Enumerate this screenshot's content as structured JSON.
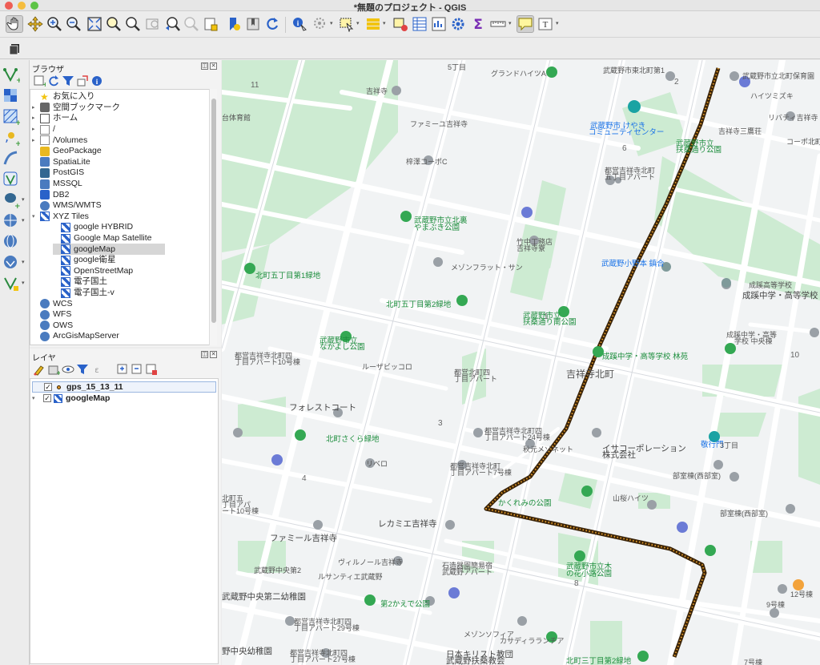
{
  "window": {
    "title": "*無題のプロジェクト - QGIS"
  },
  "toolbar": {
    "icons": [
      "pan-hand-icon",
      "pan-to-selection-icon",
      "zoom-in-icon",
      "zoom-out-icon",
      "zoom-full-icon",
      "zoom-to-selection-icon",
      "zoom-to-layer-icon",
      "zoom-native-icon",
      "zoom-last-icon",
      "zoom-next-icon",
      "new-bookmark-icon",
      "show-bookmarks-icon",
      "refresh-icon",
      "identify-icon",
      "actions-icon",
      "select-features-icon",
      "attribute-table-icon",
      "deselect-icon",
      "field-calculator-icon",
      "processing-gear-icon",
      "statistics-sigma-icon",
      "measure-icon",
      "map-tips-icon",
      "text-annotation-icon"
    ]
  },
  "browser": {
    "title": "ブラウザ",
    "items": [
      {
        "label": "お気に入り",
        "icon": "star-icon",
        "expand": ""
      },
      {
        "label": "空間ブックマーク",
        "icon": "bookmark-icon",
        "expand": "▸"
      },
      {
        "label": "ホーム",
        "icon": "home-icon",
        "expand": "▸"
      },
      {
        "label": "/",
        "icon": "folder-icon",
        "expand": "▸"
      },
      {
        "label": "/Volumes",
        "icon": "folder-icon",
        "expand": "▸"
      },
      {
        "label": "GeoPackage",
        "icon": "geopackage-icon",
        "expand": ""
      },
      {
        "label": "SpatiaLite",
        "icon": "spatialite-icon",
        "expand": ""
      },
      {
        "label": "PostGIS",
        "icon": "postgis-icon",
        "expand": ""
      },
      {
        "label": "MSSQL",
        "icon": "mssql-icon",
        "expand": ""
      },
      {
        "label": "DB2",
        "icon": "db2-icon",
        "expand": ""
      },
      {
        "label": "WMS/WMTS",
        "icon": "wms-icon",
        "expand": ""
      },
      {
        "label": "XYZ Tiles",
        "icon": "xyz-icon",
        "expand": "▾"
      },
      {
        "label": "google HYBRID",
        "icon": "tile-icon",
        "expand": "",
        "indent": 1
      },
      {
        "label": "Google Map Satellite",
        "icon": "tile-icon",
        "expand": "",
        "indent": 1
      },
      {
        "label": "googleMap",
        "icon": "tile-icon",
        "expand": "",
        "indent": 1,
        "selected": true
      },
      {
        "label": "google衛星",
        "icon": "tile-icon",
        "expand": "",
        "indent": 1
      },
      {
        "label": "OpenStreetMap",
        "icon": "tile-icon",
        "expand": "",
        "indent": 1
      },
      {
        "label": "電子国土",
        "icon": "tile-icon",
        "expand": "",
        "indent": 1
      },
      {
        "label": "電子国土-v",
        "icon": "tile-icon",
        "expand": "",
        "indent": 1
      },
      {
        "label": "WCS",
        "icon": "globe-icon",
        "expand": ""
      },
      {
        "label": "WFS",
        "icon": "globe-icon",
        "expand": ""
      },
      {
        "label": "OWS",
        "icon": "globe-icon",
        "expand": ""
      },
      {
        "label": "ArcGisMapServer",
        "icon": "globe-icon",
        "expand": ""
      }
    ]
  },
  "layers": {
    "title": "レイヤ",
    "items": [
      {
        "label": "gps_15_13_11",
        "checked": "✓",
        "icon": "point-layer-icon",
        "selected": true
      },
      {
        "label": "googleMap",
        "checked": "✓",
        "icon": "tile-layer-icon",
        "selected": false
      }
    ]
  },
  "map": {
    "labels": [
      {
        "text": "11",
        "cls": "num"
      },
      {
        "text": "台体育館",
        "cls": ""
      },
      {
        "text": "吉祥寺",
        "cls": ""
      },
      {
        "text": "グランドハイツA",
        "cls": ""
      },
      {
        "text": "5丁目",
        "cls": ""
      },
      {
        "text": "武蔵野市東北町第1",
        "cls": ""
      },
      {
        "text": "2",
        "cls": "num"
      },
      {
        "text": "武蔵野市立北町保育園",
        "cls": ""
      },
      {
        "text": "ハイツミズキ",
        "cls": ""
      },
      {
        "text": "リバティ吉祥寺",
        "cls": ""
      },
      {
        "text": "ファミーユ吉祥寺",
        "cls": ""
      },
      {
        "text": "武蔵野市 けやき",
        "cls": "teal"
      },
      {
        "text": "コミュニティセンター",
        "cls": "teal"
      },
      {
        "text": "吉祥寺三鷹荘",
        "cls": ""
      },
      {
        "text": "コーポ北町",
        "cls": ""
      },
      {
        "text": "武蔵野市立",
        "cls": "green"
      },
      {
        "text": "扶桑通り公園",
        "cls": "green"
      },
      {
        "text": "6",
        "cls": "num"
      },
      {
        "text": "梓澤コーポC",
        "cls": ""
      },
      {
        "text": "都営吉祥寺北町",
        "cls": ""
      },
      {
        "text": "五丁目アパート",
        "cls": ""
      },
      {
        "text": "武蔵野市立北裏",
        "cls": "green"
      },
      {
        "text": "やまぶき公園",
        "cls": "green"
      },
      {
        "text": "竹中工務店",
        "cls": ""
      },
      {
        "text": "吉祥寺寮",
        "cls": ""
      },
      {
        "text": "メゾンフラット・サン",
        "cls": ""
      },
      {
        "text": "武蔵野小野本 鎮合",
        "cls": "teal"
      },
      {
        "text": "北町五丁目第1緑地",
        "cls": "green"
      },
      {
        "text": "北町五丁目第2緑地",
        "cls": "green"
      },
      {
        "text": "1",
        "cls": "num"
      },
      {
        "text": "成蹊高等学校",
        "cls": ""
      },
      {
        "text": "成蹊中学・高等学校",
        "cls": "dark"
      },
      {
        "text": "武蔵野市立",
        "cls": "green"
      },
      {
        "text": "扶桑通り南公園",
        "cls": "green"
      },
      {
        "text": "成蹊中学・高等",
        "cls": ""
      },
      {
        "text": "学校 中央棟",
        "cls": ""
      },
      {
        "text": "武蔵野市立",
        "cls": "green"
      },
      {
        "text": "なかよし公園",
        "cls": "green"
      },
      {
        "text": "都営吉祥寺北町四",
        "cls": ""
      },
      {
        "text": "丁目アパート10号棟",
        "cls": ""
      },
      {
        "text": "ルーザビッコロ",
        "cls": ""
      },
      {
        "text": "都営北町四",
        "cls": ""
      },
      {
        "text": "丁目アパート",
        "cls": ""
      },
      {
        "text": "成蹊中学・高等学校 林苑",
        "cls": "green"
      },
      {
        "text": "10",
        "cls": "num"
      },
      {
        "text": "吉祥寺北町",
        "cls": "big"
      },
      {
        "text": "フォレストコート",
        "cls": "dark"
      },
      {
        "text": "3",
        "cls": "num"
      },
      {
        "text": "都営吉祥寺北町四",
        "cls": ""
      },
      {
        "text": "丁目アパート24号棟",
        "cls": ""
      },
      {
        "text": "秋元メゾネット",
        "cls": ""
      },
      {
        "text": "イサコーポレーション",
        "cls": "dark"
      },
      {
        "text": "株式会社",
        "cls": "dark"
      },
      {
        "text": "北町さくら緑地",
        "cls": "green"
      },
      {
        "text": "リベロ",
        "cls": ""
      },
      {
        "text": "都営吉祥寺北町",
        "cls": ""
      },
      {
        "text": "丁目アパート7号棟",
        "cls": ""
      },
      {
        "text": "4",
        "cls": "num"
      },
      {
        "text": "敬行門",
        "cls": "teal"
      },
      {
        "text": "3丁目",
        "cls": ""
      },
      {
        "text": "部室棟(西部室)",
        "cls": ""
      },
      {
        "text": "山桜ハイツ",
        "cls": ""
      },
      {
        "text": "かくれみの公園",
        "cls": "green"
      },
      {
        "text": "部室棟(西部室)",
        "cls": ""
      },
      {
        "text": "ファミール吉祥寺",
        "cls": "dark"
      },
      {
        "text": "レカミエ吉祥寺",
        "cls": "dark"
      },
      {
        "text": "ヴィルノール吉祥寺",
        "cls": ""
      },
      {
        "text": "石造器園簡易宿",
        "cls": ""
      },
      {
        "text": "武蔵野アパート",
        "cls": ""
      },
      {
        "text": "武蔵野市立木",
        "cls": "green"
      },
      {
        "text": "の花小路公園",
        "cls": "green"
      },
      {
        "text": "武蔵野中央第2",
        "cls": ""
      },
      {
        "text": "ルサンティエ武蔵野",
        "cls": ""
      },
      {
        "text": "8",
        "cls": "num"
      },
      {
        "text": "12号棟",
        "cls": ""
      },
      {
        "text": "武蔵野中央第二幼稚園",
        "cls": "dark"
      },
      {
        "text": "第2かえで公園",
        "cls": "green"
      },
      {
        "text": "9号棟",
        "cls": ""
      },
      {
        "text": "都営吉祥寺北町四",
        "cls": ""
      },
      {
        "text": "丁目アパート29号棟",
        "cls": ""
      },
      {
        "text": "メゾンソフィア",
        "cls": ""
      },
      {
        "text": "カサディラランチア",
        "cls": ""
      },
      {
        "text": "都営吉祥寺北町四",
        "cls": ""
      },
      {
        "text": "丁目アパート27号棟",
        "cls": ""
      },
      {
        "text": "日本キリスト教団",
        "cls": "dark"
      },
      {
        "text": "武蔵野扶桑教会",
        "cls": "dark"
      },
      {
        "text": "北町三丁目第2緑地",
        "cls": "green"
      },
      {
        "text": "野中央幼稚園",
        "cls": "dark"
      },
      {
        "text": "7号棟",
        "cls": ""
      },
      {
        "text": "北町五",
        "cls": ""
      },
      {
        "text": "丁目アパ",
        "cls": ""
      },
      {
        "text": "ート10号棟",
        "cls": ""
      }
    ]
  }
}
